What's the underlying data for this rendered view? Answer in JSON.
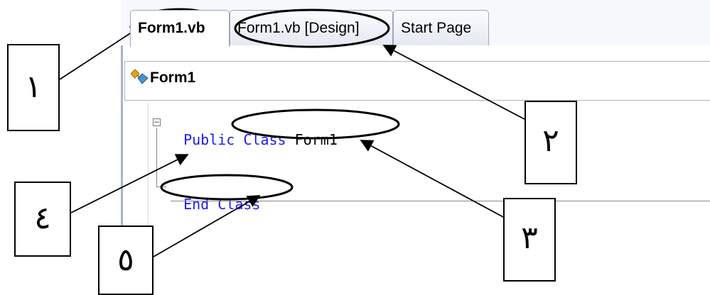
{
  "tabs": [
    {
      "label": "Form1.vb",
      "active": true
    },
    {
      "label": "Form1.vb [Design]",
      "active": false
    },
    {
      "label": "Start Page",
      "active": false
    }
  ],
  "navbar": {
    "class_selector": "Form1",
    "icon": "class-icon"
  },
  "code": {
    "line1": {
      "kw1": "Public",
      "kw2": "Class",
      "name": "Form1"
    },
    "line3": {
      "kw1": "End",
      "kw2": "Class"
    },
    "collapse_symbol": "−"
  },
  "callouts": [
    "١",
    "٢",
    "٣",
    "٤",
    "٥"
  ],
  "colors": {
    "keyword": "#1b1bf2",
    "tab_border": "#9aa8bb"
  }
}
